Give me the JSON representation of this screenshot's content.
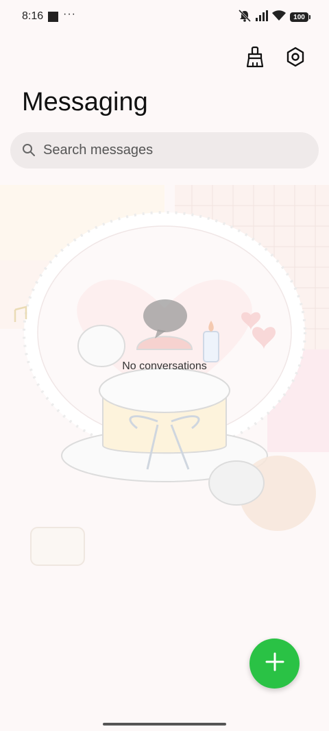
{
  "status_bar": {
    "time": "8:16",
    "dots": "···",
    "battery": "100",
    "icons": [
      "mute-vibrate-icon",
      "signal-icon",
      "wifi-icon",
      "battery-icon"
    ]
  },
  "header": {
    "title": "Messaging",
    "actions": [
      "broom-clean-icon",
      "settings-hexagon-icon"
    ]
  },
  "search": {
    "placeholder": "Search messages",
    "value": ""
  },
  "empty_state": {
    "message": "No conversations",
    "icon": "chat-bubble-icon"
  },
  "fab": {
    "icon": "plus-icon",
    "color": "#2ac245"
  },
  "colors": {
    "background": "#fdf8f8",
    "search_bg": "#efeaea",
    "accent": "#2ac245"
  }
}
